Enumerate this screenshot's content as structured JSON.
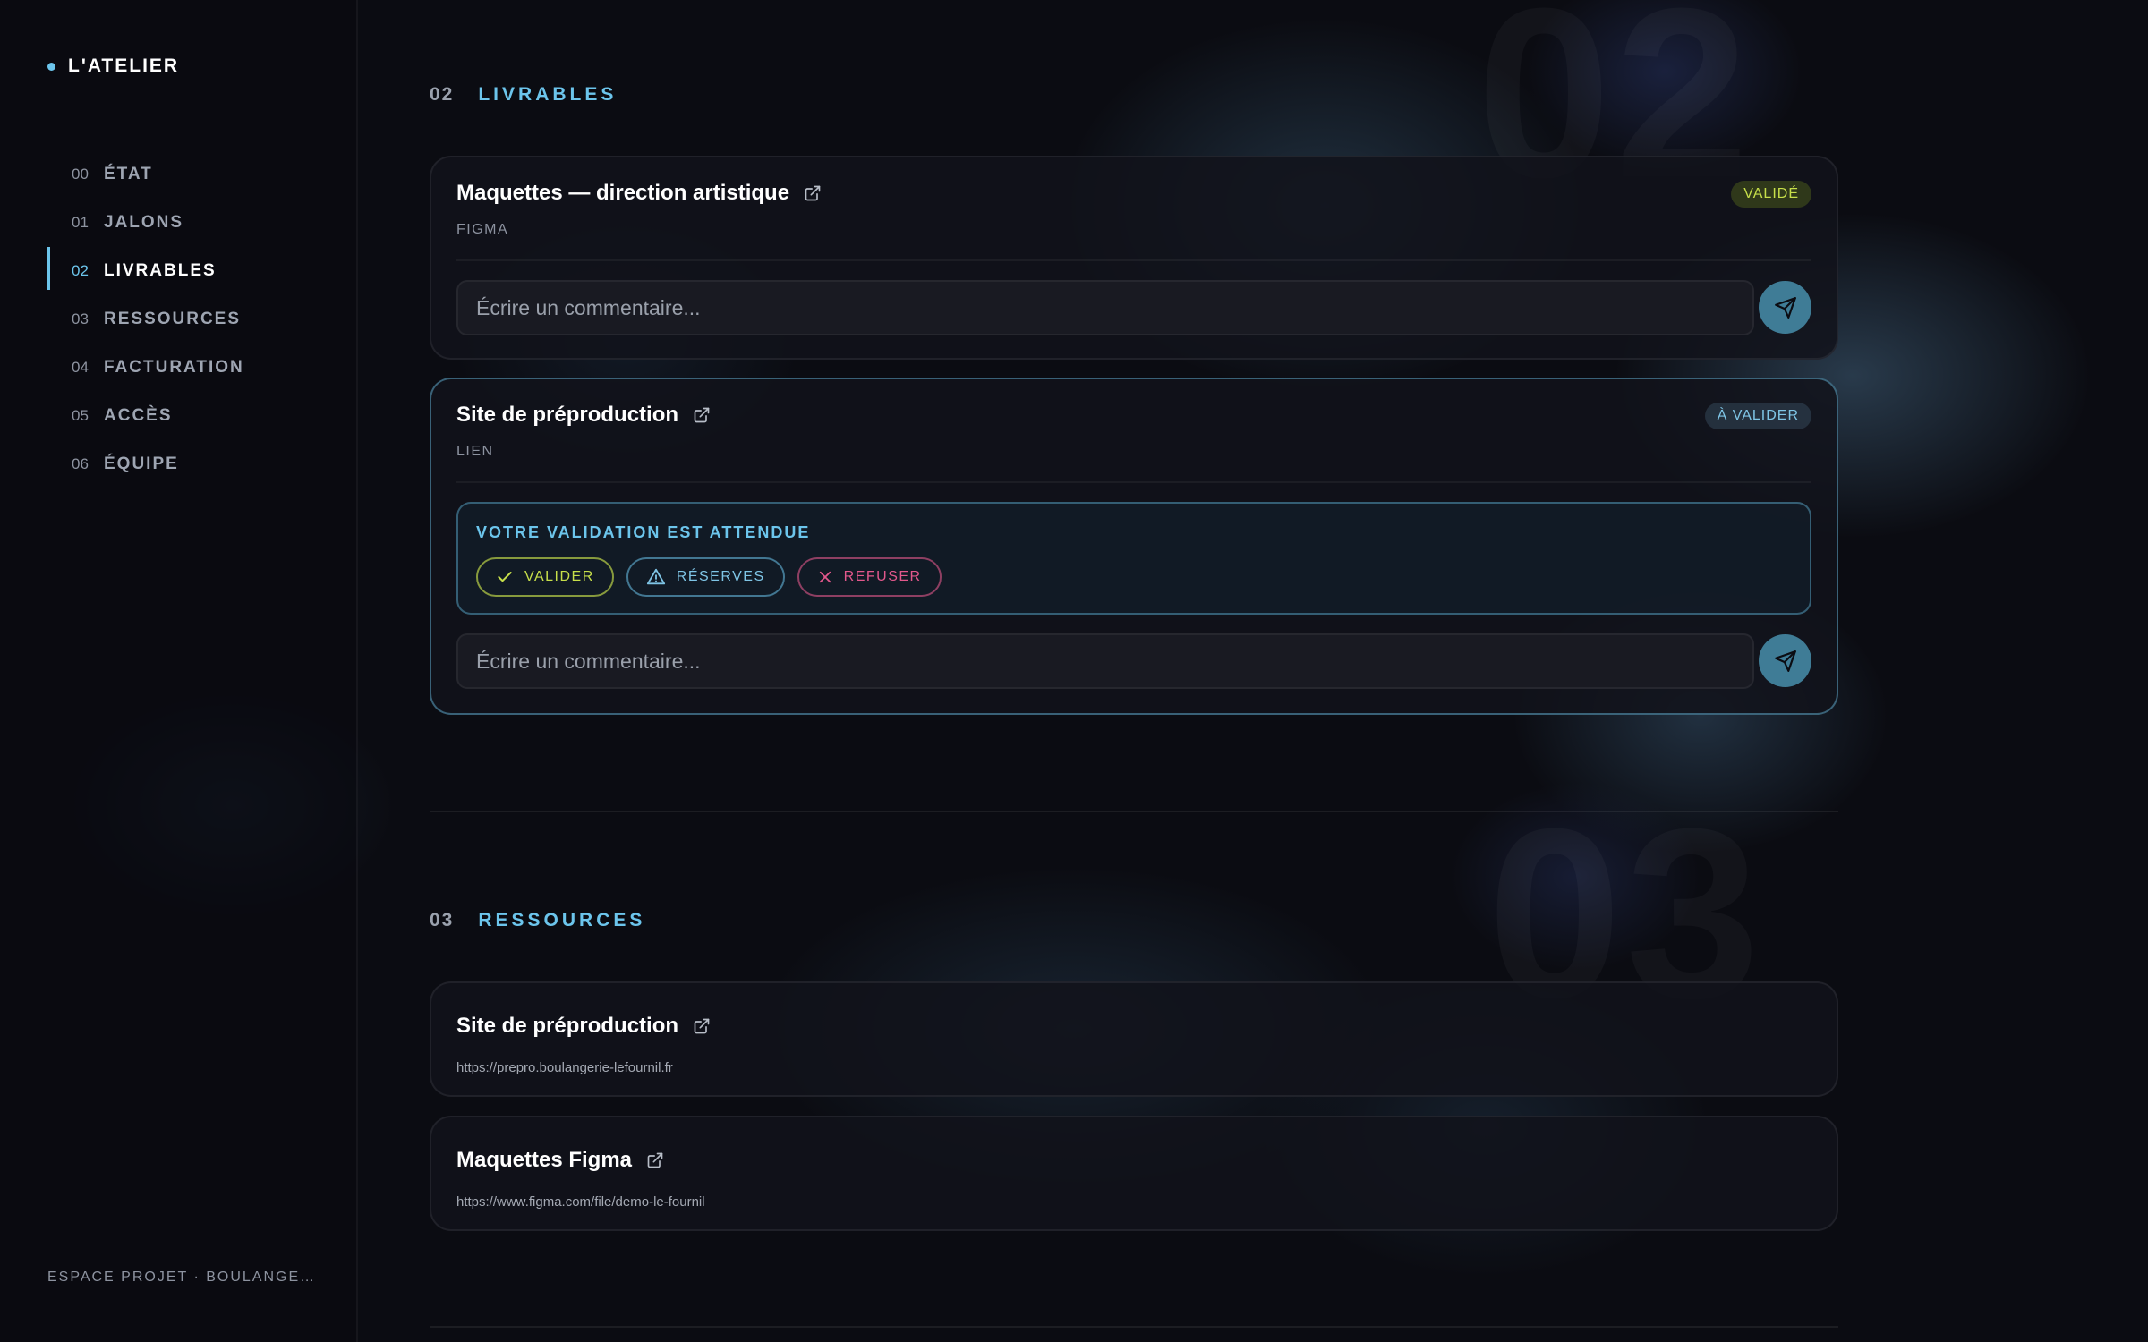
{
  "sidebar": {
    "brand": "L'ATELIER",
    "nav": [
      {
        "num": "00",
        "label": "ÉTAT"
      },
      {
        "num": "01",
        "label": "JALONS"
      },
      {
        "num": "02",
        "label": "LIVRABLES"
      },
      {
        "num": "03",
        "label": "RESSOURCES"
      },
      {
        "num": "04",
        "label": "FACTURATION"
      },
      {
        "num": "05",
        "label": "ACCÈS"
      },
      {
        "num": "06",
        "label": "ÉQUIPE"
      }
    ],
    "active_index": 2,
    "footer": "ESPACE PROJET · BOULANGE…"
  },
  "livrables": {
    "num": "02",
    "title": "LIVRABLES",
    "bg_number": "02",
    "items": [
      {
        "title": "Maquettes — direction artistique",
        "type": "FIGMA",
        "status": "VALIDÉ",
        "comment_placeholder": "Écrire un commentaire..."
      },
      {
        "title": "Site de préproduction",
        "type": "LIEN",
        "status": "À VALIDER",
        "validation": {
          "title": "VOTRE VALIDATION EST ATTENDUE",
          "valider": "VALIDER",
          "reserves": "RÉSERVES",
          "refuser": "REFUSER"
        },
        "comment_placeholder": "Écrire un commentaire..."
      }
    ]
  },
  "ressources": {
    "num": "03",
    "title": "RESSOURCES",
    "bg_number": "03",
    "items": [
      {
        "title": "Site de préproduction",
        "url": "https://prepro.boulangerie-lefournil.fr"
      },
      {
        "title": "Maquettes Figma",
        "url": "https://www.figma.com/file/demo-le-fournil"
      }
    ]
  },
  "colors": {
    "accent": "#6cc5ec",
    "background": "#0b0c12",
    "validated": "#c7df4a",
    "reserves": "#7fc5e6",
    "refuse": "#e2588c",
    "send_button": "#3f7c96"
  },
  "icons": [
    "external-link-icon",
    "send-icon",
    "check-icon",
    "warning-icon",
    "close-icon"
  ]
}
